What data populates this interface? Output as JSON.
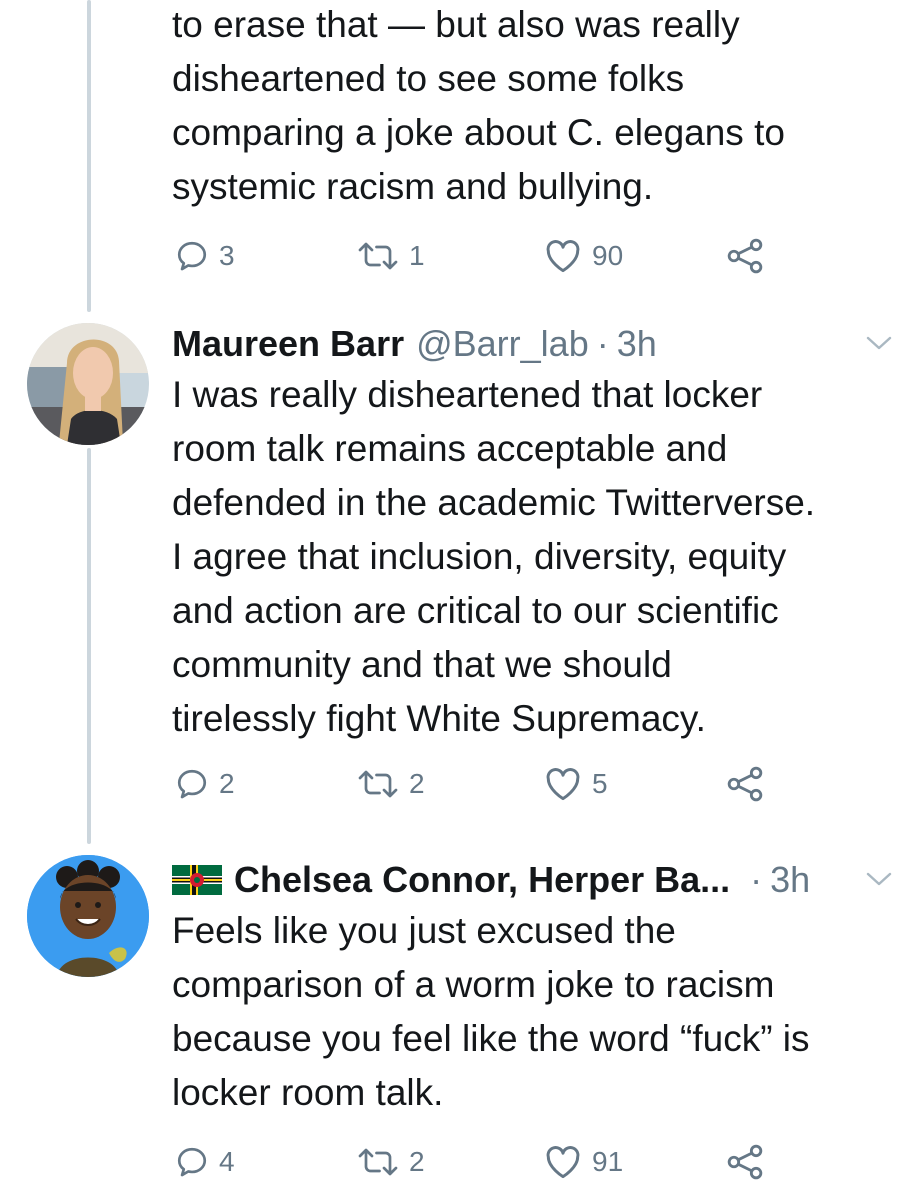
{
  "thread": [
    {
      "text": "to erase that — but also was really\ndisheartened to see some folks\ncomparing a joke about C. elegans to\nsystemic racism and bullying.",
      "replies": "3",
      "retweets": "1",
      "likes": "90"
    },
    {
      "author": "Maureen Barr",
      "handle": "@Barr_lab",
      "separator": "·",
      "time": "3h",
      "text": "I was really disheartened that locker\nroom talk remains acceptable and\ndefended in the academic Twitterverse.\nI agree that inclusion, diversity, equity\nand action are critical to our scientific\ncommunity and that we should\ntirelessly fight White Supremacy.",
      "replies": "2",
      "retweets": "2",
      "likes": "5"
    },
    {
      "author": "Chelsea Connor, Herper Ba...",
      "separator": "·",
      "time": "3h",
      "text": "Feels like you just excused the\ncomparison of a worm joke to racism\nbecause you feel like the word “fuck” is\nlocker room talk.",
      "replies": "4",
      "retweets": "2",
      "likes": "91"
    }
  ],
  "icons": {
    "reply": "reply-icon",
    "retweet": "retweet-icon",
    "like": "heart-icon",
    "share": "share-icon",
    "menu": "chevron-down-icon",
    "flag": "dominica-flag-icon"
  },
  "colors": {
    "text": "#14171a",
    "secondary": "#657786",
    "thread_line": "#ccd6dd",
    "avatar2_bg": "#3b9cf0"
  }
}
